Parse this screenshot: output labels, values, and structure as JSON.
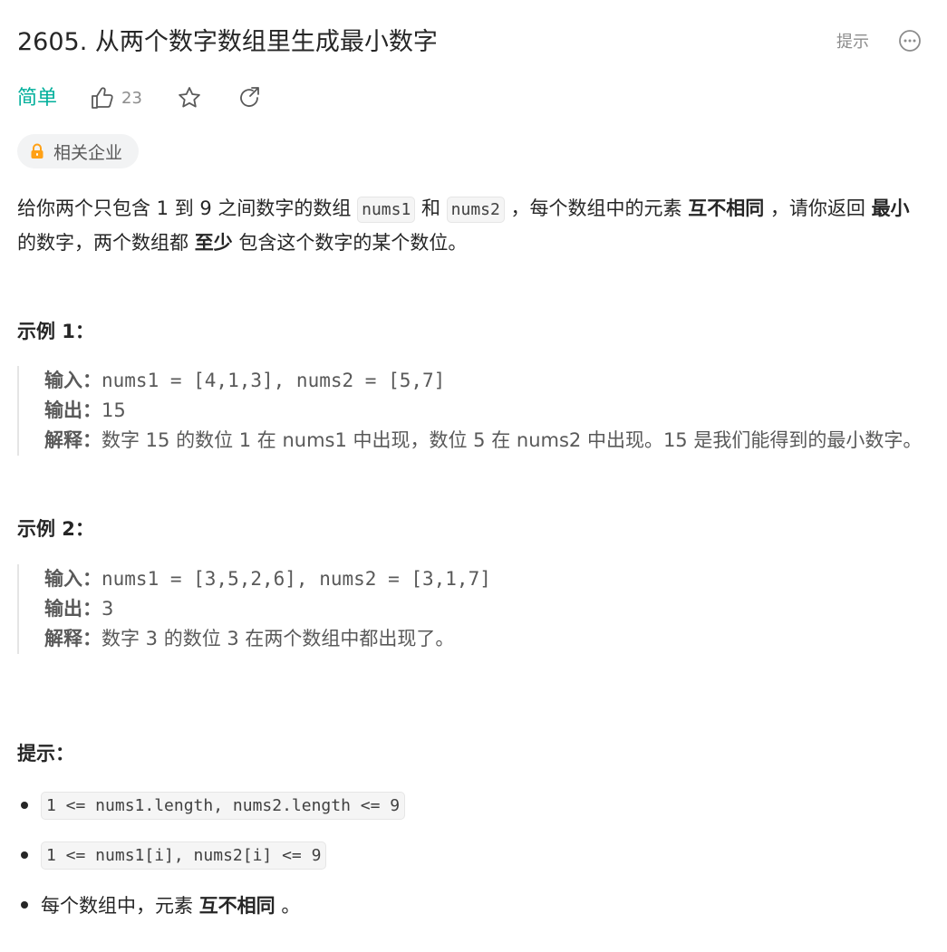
{
  "title": "2605. 从两个数字数组里生成最小数字",
  "header_actions": {
    "hint_label": "提示",
    "more_icon": "more-dots-icon"
  },
  "meta": {
    "difficulty": "简单",
    "likes": "23",
    "like_icon": "thumbs-up-icon",
    "favorite_icon": "star-icon",
    "share_icon": "share-icon",
    "difficulty_color": "#00af9b"
  },
  "company_tag": {
    "label": "相关企业",
    "icon": "lock-icon",
    "icon_color": "#ffa116"
  },
  "description": {
    "p1": "给你两个只包含 1 到 9 之间数字的数组 ",
    "code1": "nums1",
    "p2": " 和 ",
    "code2": "nums2",
    "p3": " ，每个数组中的元素 ",
    "bold1": "互不相同",
    "p4": " ，请你返回 ",
    "bold2": "最小",
    "p5": " 的数字，两个数组都 ",
    "bold3": "至少",
    "p6": " 包含这个数字的某个数位。"
  },
  "examples": [
    {
      "heading": "示例 1：",
      "input_label": "输入：",
      "input": "nums1 = [4,1,3], nums2 = [5,7]",
      "output_label": "输出：",
      "output": "15",
      "explanation_label": "解释：",
      "explanation": "数字 15 的数位 1 在 nums1 中出现，数位 5 在 nums2 中出现。15 是我们能得到的最小数字。"
    },
    {
      "heading": "示例 2：",
      "input_label": "输入：",
      "input": "nums1 = [3,5,2,6], nums2 = [3,1,7]",
      "output_label": "输出：",
      "output": "3",
      "explanation_label": "解释：",
      "explanation": "数字 3 的数位 3 在两个数组中都出现了。"
    }
  ],
  "constraints": {
    "heading": "提示：",
    "items": [
      {
        "code": "1 <= nums1.length, nums2.length <= 9"
      },
      {
        "code": "1 <= nums1[i], nums2[i] <= 9"
      },
      {
        "text": "每个数组中，元素 ",
        "bold": "互不相同",
        "tail": " 。"
      }
    ]
  }
}
